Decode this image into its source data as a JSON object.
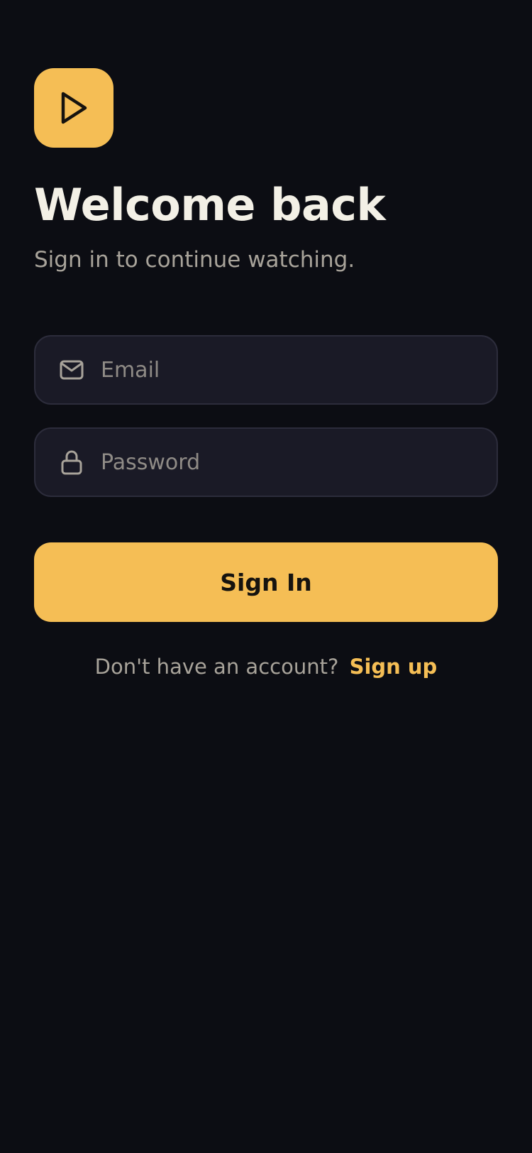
{
  "header": {
    "logo_icon": "play-icon",
    "title": "Welcome back",
    "subtitle": "Sign in to continue watching."
  },
  "form": {
    "email": {
      "icon": "mail-icon",
      "placeholder": "Email",
      "value": ""
    },
    "password": {
      "icon": "lock-icon",
      "placeholder": "Password",
      "value": ""
    },
    "submit_label": "Sign In"
  },
  "footer": {
    "prompt": "Don't have an account?",
    "link_label": "Sign up"
  },
  "colors": {
    "background": "#0c0d13",
    "accent": "#f5be55",
    "field_background": "#1a1a26",
    "field_border": "#2c2c3b",
    "title_text": "#f3f0e6",
    "muted_text": "#a8a39a"
  }
}
